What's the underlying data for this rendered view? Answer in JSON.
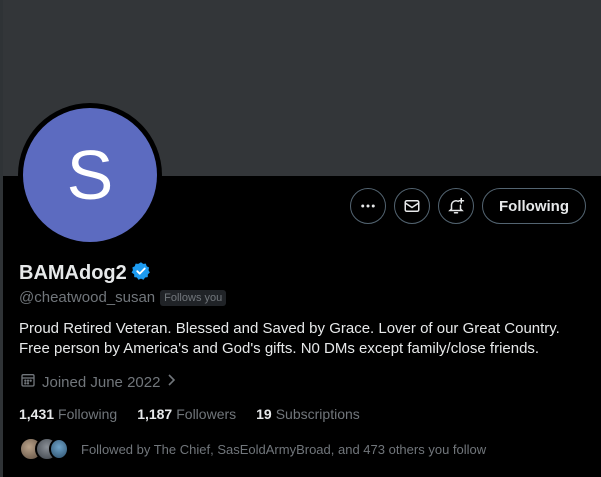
{
  "profile": {
    "avatar_letter": "S",
    "avatar_color": "#5c6bc0",
    "display_name": "BAMAdog2",
    "verified": true,
    "handle": "@cheatwood_susan",
    "follows_you_badge": "Follows you",
    "bio_lines": [
      "Proud Retired Veteran. Blessed and Saved by Grace.  Lover of our Great Country.",
      "Free person by America's and God's gifts.  N0 DMs except family/close friends."
    ],
    "joined": "Joined June 2022"
  },
  "actions": {
    "more_icon": "more-horizontal-icon",
    "message_icon": "envelope-icon",
    "notify_icon": "bell-plus-icon",
    "follow_label": "Following"
  },
  "stats": {
    "following_count": "1,431",
    "following_label": "Following",
    "followers_count": "1,187",
    "followers_label": "Followers",
    "subscriptions_count": "19",
    "subscriptions_label": "Subscriptions"
  },
  "followed_by": {
    "text": "Followed by The Chief, SasEoldArmyBroad, and 473 others you follow"
  },
  "colors": {
    "background": "#000000",
    "banner": "#333639",
    "verified": "#1d9bf0",
    "muted_text": "#71767b",
    "primary_text": "#e7e9ea"
  }
}
